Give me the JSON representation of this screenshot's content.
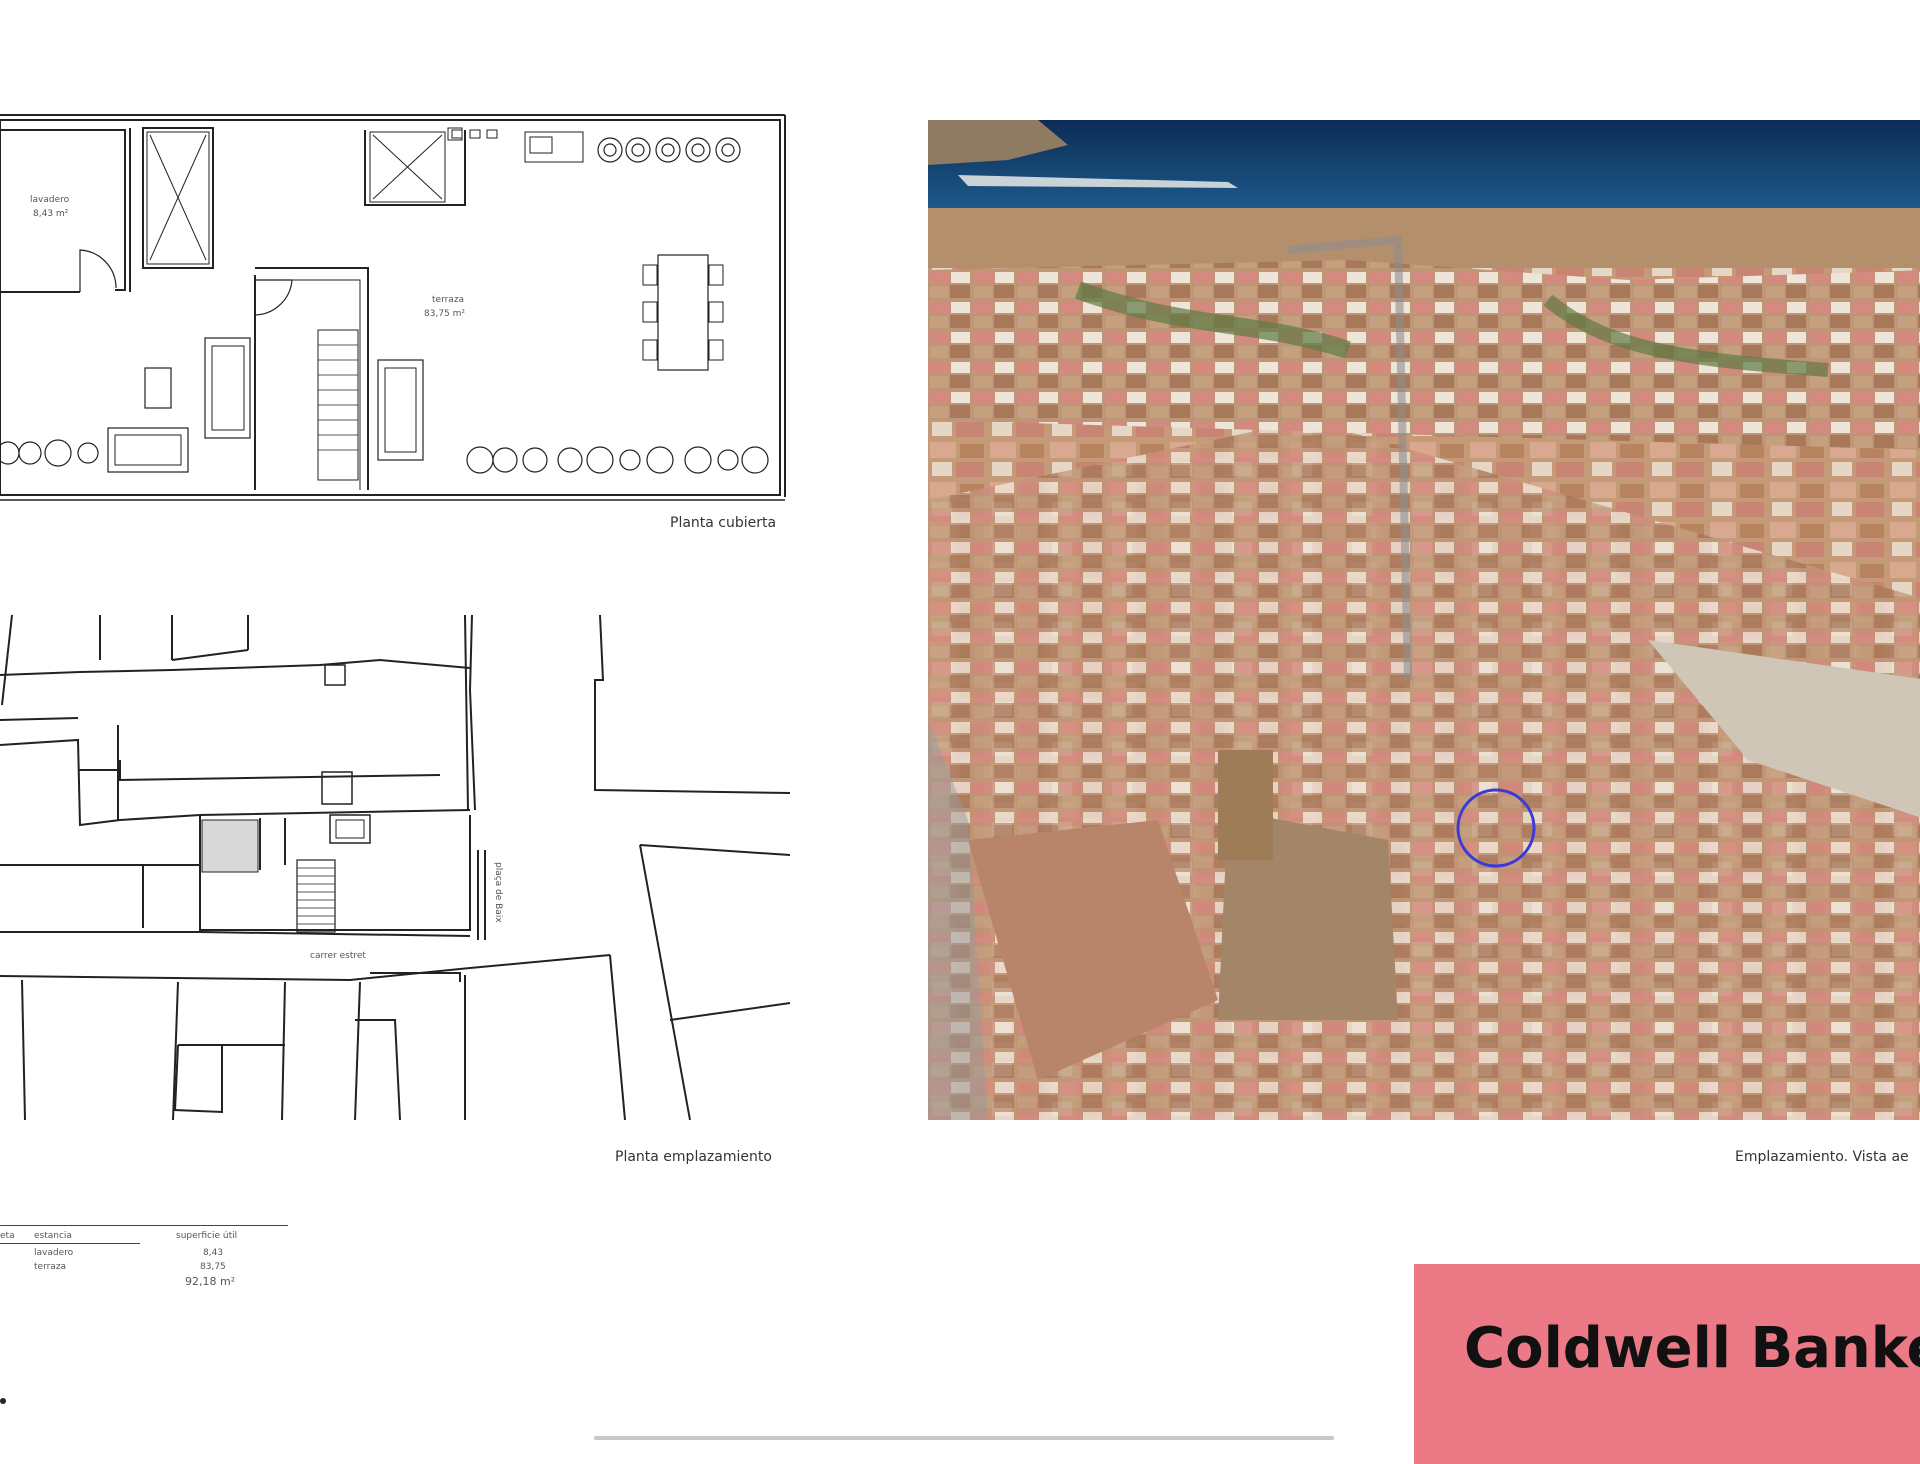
{
  "roof_plan": {
    "rooms": [
      {
        "name": "lavadero",
        "area": "8,43 m²"
      },
      {
        "name": "terraza",
        "area": "83,75 m²"
      }
    ],
    "caption": "Planta cubierta"
  },
  "site_plan": {
    "street_main": "carrer estret",
    "street_side": "plaça de Baix",
    "caption": "Planta emplazamiento"
  },
  "aerial": {
    "caption": "Emplazamiento. Vista ae",
    "marker": "circle"
  },
  "area_table": {
    "headers": [
      "planta",
      "estancia",
      "superficie útil"
    ],
    "header_left_visible": "eta",
    "rows": [
      {
        "estancia": "lavadero",
        "superficie": "8,43"
      },
      {
        "estancia": "terraza",
        "superficie": "83,75"
      }
    ],
    "total": "92,18 m²"
  },
  "brand": {
    "text": "Coldwell Banke",
    "color": "#ec7a86"
  }
}
